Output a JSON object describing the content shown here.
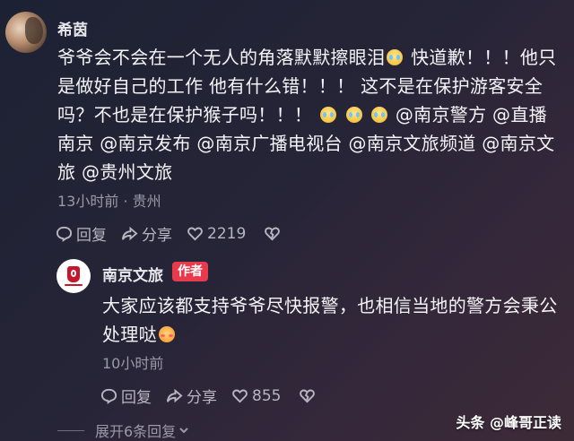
{
  "comment1": {
    "username": "希茵",
    "text_parts": [
      "爷爷会不会在一个无人的角落默默擦眼泪",
      " 快道歉！！！他只是做好自己的工作 他有什么错！！！ 这不是在保护游客安全吗？不也是在保护猴子吗！！！ ",
      " ",
      " ",
      " ",
      "@南京警方 @直播南京 @南京发布 @南京广播电视台 @南京文旅频道 @南京文旅 @贵州文旅"
    ],
    "meta": "13小时前 · 贵州",
    "actions": {
      "reply": "回复",
      "share": "分享",
      "likes": "2219"
    }
  },
  "comment2": {
    "username": "南京文旅",
    "badge": "作者",
    "text": "大家应该都支持爷爷尽快报警，也相信当地的警方会秉公处理哒",
    "meta": "10小时前",
    "actions": {
      "reply": "回复",
      "share": "分享",
      "likes": "855"
    }
  },
  "expand_replies": "展开6条回复",
  "watermark": "头条 @峰哥正读",
  "icons": {
    "user1_avatar": "user-avatar",
    "user2_avatar": "nanjing-culture-tourism-logo",
    "reply": "comment-bubble-icon",
    "share": "share-arrow-icon",
    "like": "heart-icon",
    "dislike": "broken-heart-icon",
    "expand": "chevron-down-icon",
    "emoji1": "crying-face-emoji",
    "emoji2": "shy-face-emoji"
  },
  "colors": {
    "badge": "#e83a4d",
    "meta_text": "#9a9aa6",
    "body_text": "#f4f4f6"
  }
}
